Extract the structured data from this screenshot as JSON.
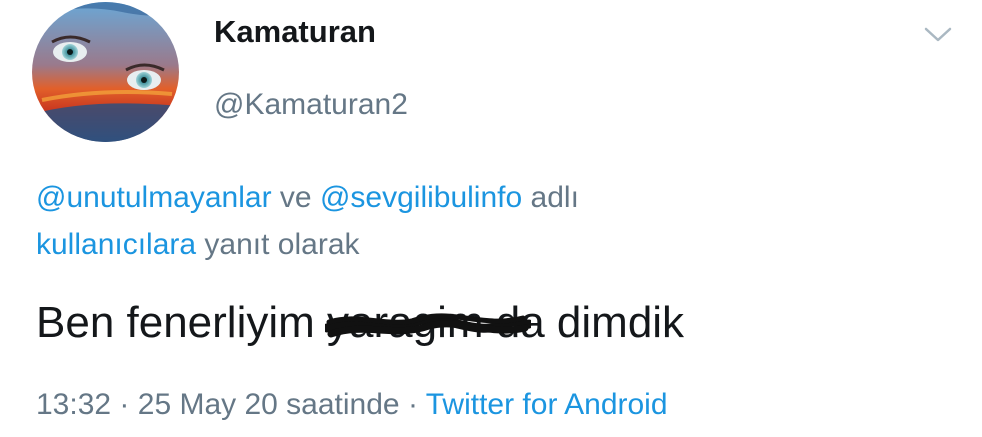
{
  "user": {
    "display_name": "Kamaturan",
    "handle": "@Kamaturan2",
    "avatar_icon": "profile-photo"
  },
  "menu": {
    "icon": "chevron-down-icon"
  },
  "reply_context": {
    "mention_1": "@unutulmayanlar",
    "connector": "ve",
    "mention_2": "@sevgilibulinfo",
    "suffix_1": "adlı",
    "suffix_link": "kullanıcılara",
    "suffix_2": "yanıt olarak"
  },
  "tweet": {
    "text_before": "Ben fenerliyim",
    "scribbled_word": "yaragim",
    "text_after": "da dimdik"
  },
  "meta": {
    "time": "13:32",
    "separator": "·",
    "date": "25 May 20 saatinde",
    "source": "Twitter for Android"
  },
  "colors": {
    "link": "#1b95e0",
    "secondary_text": "#657786",
    "primary_text": "#14171a"
  }
}
